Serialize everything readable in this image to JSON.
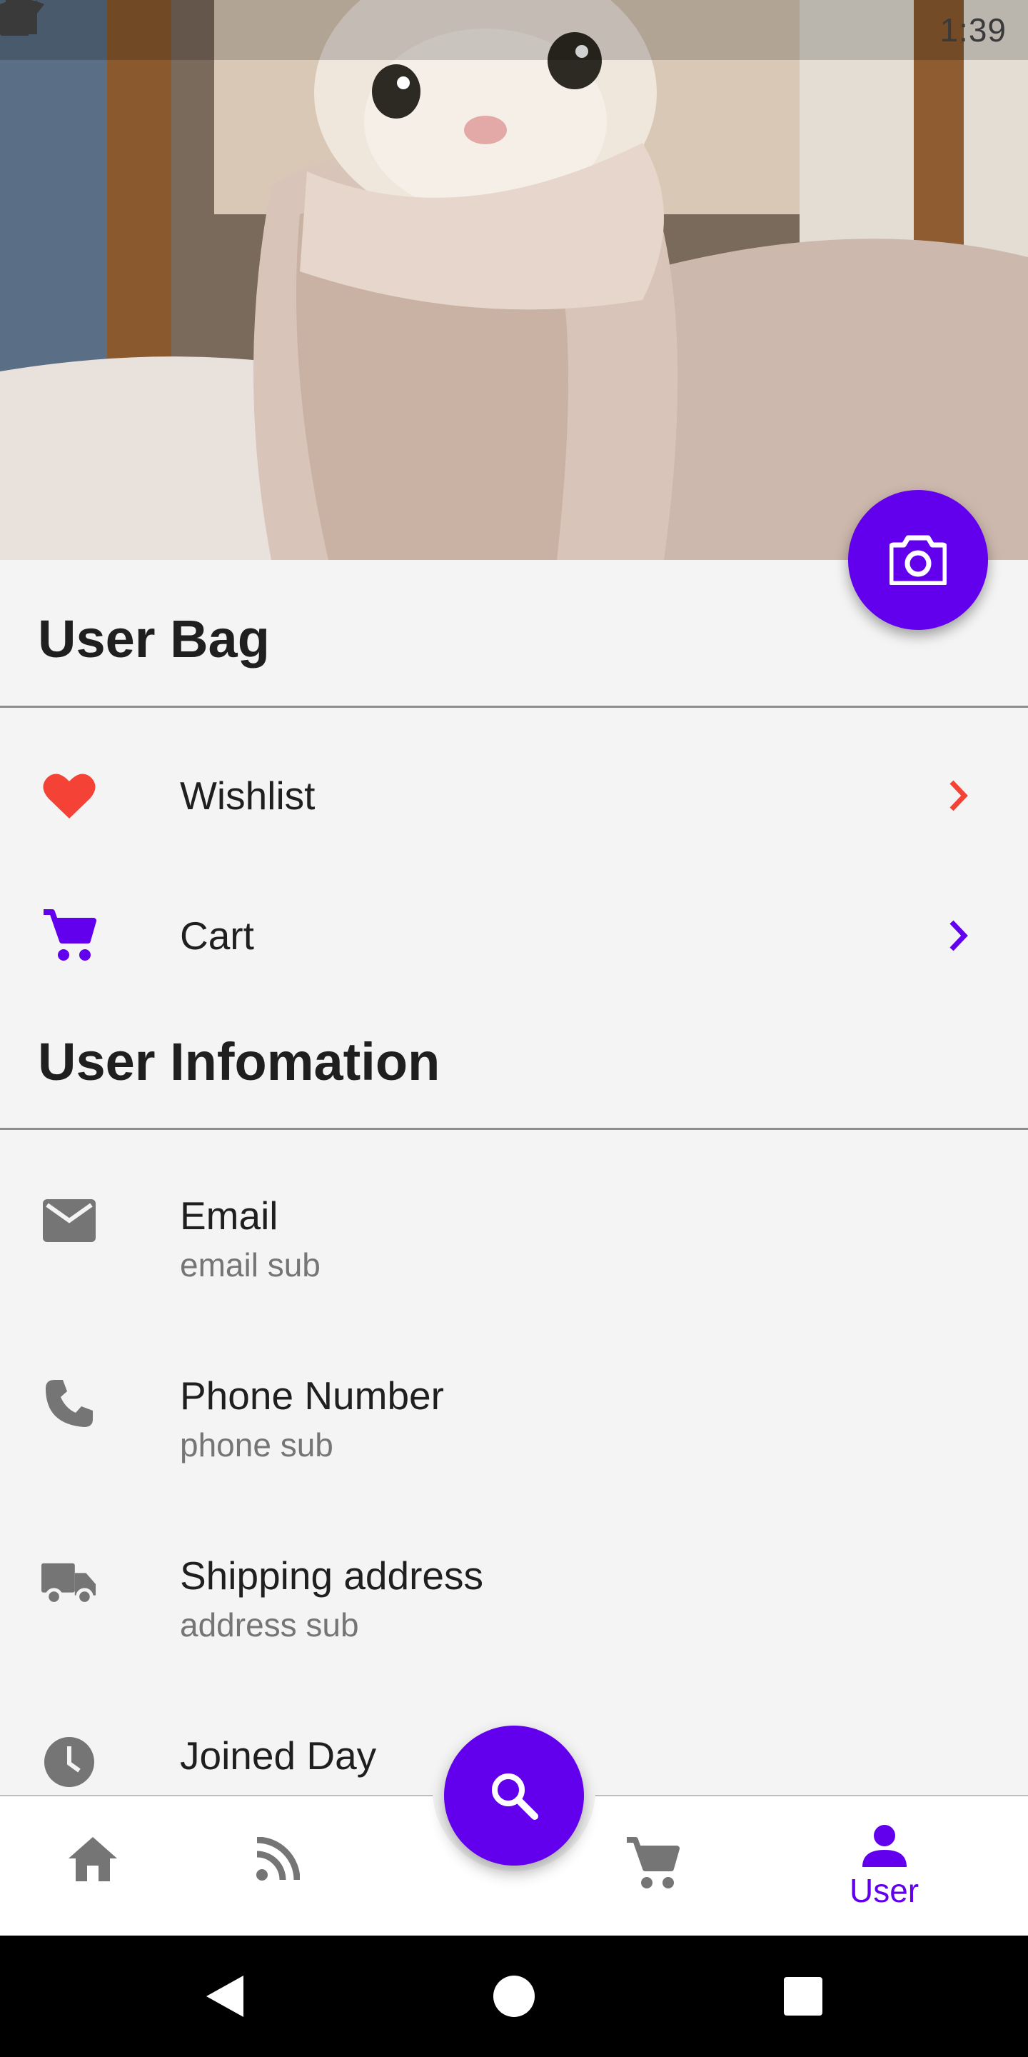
{
  "status_bar": {
    "time": "1:39"
  },
  "hero": {
    "image": "cat wrapped in blanket"
  },
  "camera_fab": {
    "icon": "camera-icon",
    "color": "#6200ee"
  },
  "user_bag": {
    "title": "User Bag",
    "items": [
      {
        "label": "Wishlist",
        "icon": "heart-icon",
        "color": "#f44336"
      },
      {
        "label": "Cart",
        "icon": "cart-icon",
        "color": "#6200ee"
      }
    ]
  },
  "user_info": {
    "title": "User Infomation",
    "items": [
      {
        "title": "Email",
        "subtitle": "email sub",
        "icon": "email-icon"
      },
      {
        "title": "Phone Number",
        "subtitle": "phone sub",
        "icon": "phone-icon"
      },
      {
        "title": "Shipping address",
        "subtitle": "address sub",
        "icon": "truck-icon"
      },
      {
        "title": "Joined Day",
        "subtitle": "",
        "icon": "clock-icon"
      }
    ]
  },
  "bottom_nav": {
    "items": [
      {
        "icon": "home-icon",
        "label": ""
      },
      {
        "icon": "feed-icon",
        "label": ""
      },
      {
        "icon": "search-icon",
        "label": ""
      },
      {
        "icon": "cart-icon",
        "label": ""
      },
      {
        "icon": "user-icon",
        "label": "User",
        "active": true
      }
    ],
    "accent": "#6200ee",
    "inactive": "#757575"
  },
  "system_nav": {
    "buttons": [
      "back",
      "home",
      "recents"
    ]
  }
}
